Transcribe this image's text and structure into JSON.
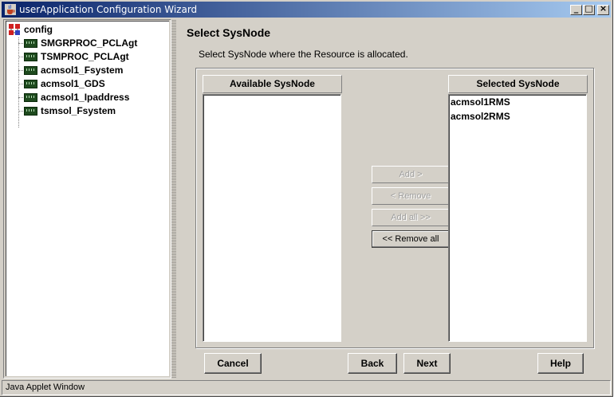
{
  "window": {
    "title": "userApplication Configuration Wizard",
    "controls": [
      "minimize-icon",
      "maximize-icon",
      "close-icon"
    ],
    "minimize_glyph": "_",
    "maximize_glyph": "□",
    "close_glyph": "×"
  },
  "tree": {
    "root": {
      "label": "config",
      "icon": "config-icon"
    },
    "items": [
      {
        "label": "SMGRPROC_PCLAgt",
        "icon": "resource-chip-icon"
      },
      {
        "label": "TSMPROC_PCLAgt",
        "icon": "resource-chip-icon"
      },
      {
        "label": "acmsol1_Fsystem",
        "icon": "resource-chip-icon"
      },
      {
        "label": "acmsol1_GDS",
        "icon": "resource-chip-icon"
      },
      {
        "label": "acmsol1_Ipaddress",
        "icon": "resource-chip-icon"
      },
      {
        "label": "tsmsol_Fsystem",
        "icon": "resource-chip-icon"
      }
    ]
  },
  "main": {
    "heading": "Select SysNode",
    "description": "Select SysNode where the Resource is allocated.",
    "available": {
      "header": "Available SysNode",
      "items": []
    },
    "selected": {
      "header": "Selected SysNode",
      "items": [
        "acmsol1RMS",
        "acmsol2RMS"
      ]
    },
    "move_buttons": {
      "add": "Add >",
      "remove": "< Remove",
      "add_all": "Add all >>",
      "remove_all": "<< Remove all"
    }
  },
  "footer": {
    "cancel": "Cancel",
    "back": "Back",
    "next": "Next",
    "help": "Help"
  },
  "status": {
    "text": "Java Applet Window"
  },
  "colors": {
    "title_start": "#0a246a",
    "title_end": "#a6caf0",
    "face": "#d4d0c8"
  }
}
